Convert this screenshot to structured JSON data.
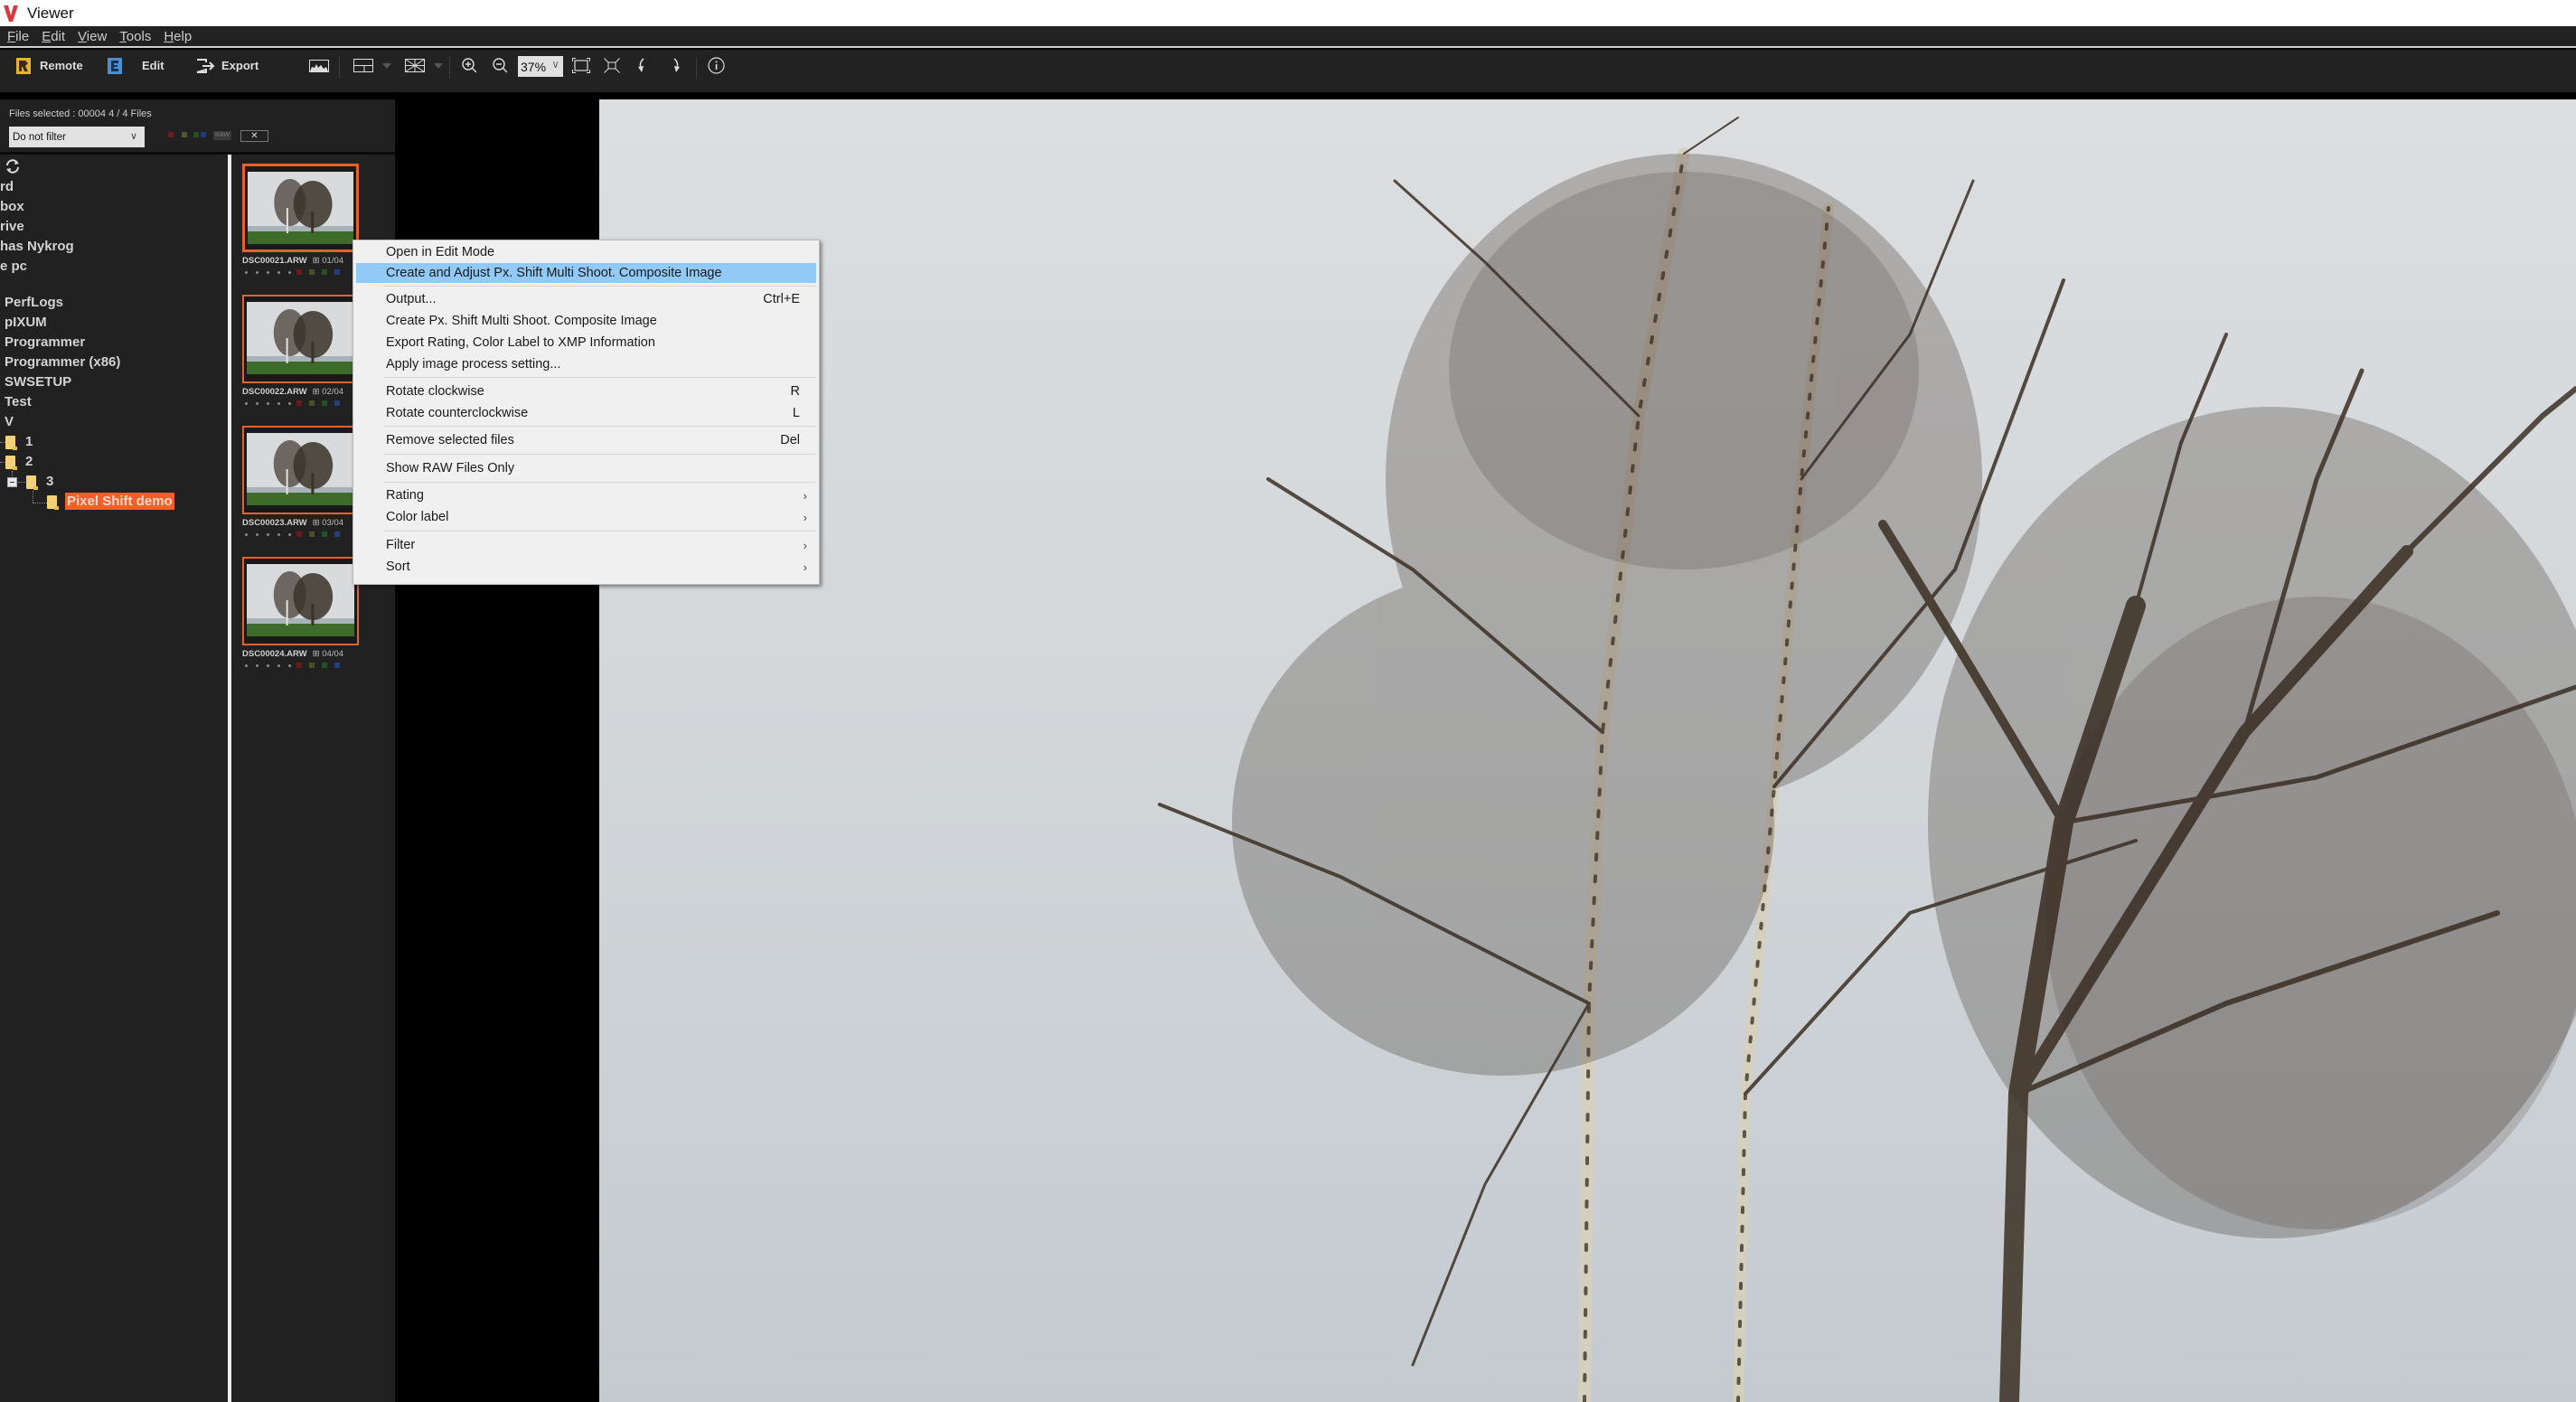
{
  "window": {
    "title": "Viewer",
    "app_icon": "viewer-v-logo"
  },
  "menubar": [
    {
      "label": "File",
      "accel": "F"
    },
    {
      "label": "Edit",
      "accel": "E"
    },
    {
      "label": "View",
      "accel": "V"
    },
    {
      "label": "Tools",
      "accel": "T"
    },
    {
      "label": "Help",
      "accel": "H"
    }
  ],
  "toolbar": {
    "remote_label": "Remote",
    "edit_label": "Edit",
    "export_label": "Export",
    "zoom_value": "37%",
    "icons": [
      "histogram-icon",
      "layout-icon",
      "grid-overlay-icon",
      "zoom-in-icon",
      "zoom-out-icon",
      "fit-screen-icon",
      "actual-size-icon",
      "rotate-left-icon",
      "rotate-right-icon",
      "info-icon"
    ]
  },
  "filterbar": {
    "files_selected": "Files selected : 00004   4 / 4 Files",
    "filter_value": "Do not filter",
    "color_filters": [
      "#7a1f1f",
      "#5a5a33",
      "#2a5a2a",
      "#2a3f7a"
    ],
    "raw_label": "RAW",
    "clear_label": "✕"
  },
  "tree": {
    "items": [
      "rd",
      "box",
      "rive",
      "has Nykrog",
      "e pc",
      "PerfLogs",
      "pIXUM",
      "Programmer",
      "Programmer (x86)",
      "SWSETUP",
      "Test",
      "V",
      "1",
      "2",
      "3",
      "Pixel Shift demo"
    ],
    "selected": "Pixel Shift demo"
  },
  "thumbnails": [
    {
      "name": "DSC00021.ARW",
      "index": "01/04"
    },
    {
      "name": "DSC00022.ARW",
      "index": "02/04"
    },
    {
      "name": "DSC00023.ARW",
      "index": "03/04"
    },
    {
      "name": "DSC00024.ARW",
      "index": "04/04"
    }
  ],
  "label_colors": [
    "#6a1a1a",
    "#4d4d2a",
    "#245224",
    "#23407a"
  ],
  "context_menu": {
    "items": [
      {
        "label": "Open in Edit Mode",
        "shortcut": ""
      },
      {
        "label": "Create and Adjust Px. Shift Multi Shoot. Composite Image",
        "shortcut": "",
        "highlighted": true
      },
      {
        "label": "Output...",
        "shortcut": "Ctrl+E"
      },
      {
        "label": "Create Px. Shift Multi Shoot. Composite Image",
        "shortcut": ""
      },
      {
        "label": "Export Rating, Color Label to XMP Information",
        "shortcut": ""
      },
      {
        "label": "Apply image process setting...",
        "shortcut": ""
      },
      {
        "label": "Rotate clockwise",
        "shortcut": "R"
      },
      {
        "label": "Rotate counterclockwise",
        "shortcut": "L"
      },
      {
        "label": "Remove selected files",
        "shortcut": "Del"
      },
      {
        "label": "Show RAW Files Only",
        "shortcut": ""
      },
      {
        "label": "Rating",
        "submenu": "›"
      },
      {
        "label": "Color label",
        "submenu": "›"
      },
      {
        "label": "Filter",
        "submenu": "›"
      },
      {
        "label": "Sort",
        "submenu": "›"
      }
    ]
  },
  "colors": {
    "accent_selection": "#f0602a",
    "menu_highlight": "#91c9f7",
    "panel_bg": "#212121"
  }
}
